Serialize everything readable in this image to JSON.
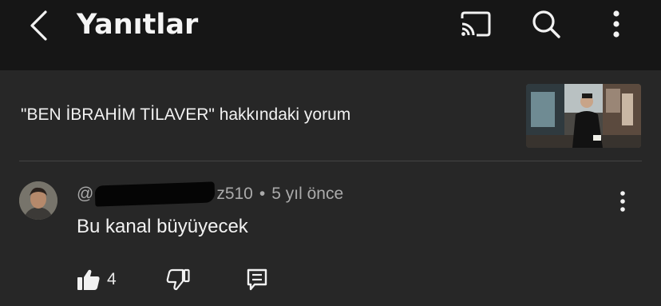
{
  "header": {
    "title": "Yanıtlar",
    "icons": [
      "back-arrow-icon",
      "cast-icon",
      "search-icon",
      "more-vertical-icon"
    ]
  },
  "context": {
    "text": "\"BEN İBRAHİM TİLAVER\" hakkındaki yorum",
    "thumbnail": "video-thumbnail"
  },
  "comment": {
    "author_prefix": "@",
    "author_suffix": "z510",
    "separator": "•",
    "time": "5 yıl önce",
    "text": "Bu kanal büyüyecek",
    "like_count": "4"
  },
  "colors": {
    "topbar": "#161616",
    "background": "#272727",
    "text": "#f1f1f1",
    "secondary_text": "#aaaaaa"
  }
}
